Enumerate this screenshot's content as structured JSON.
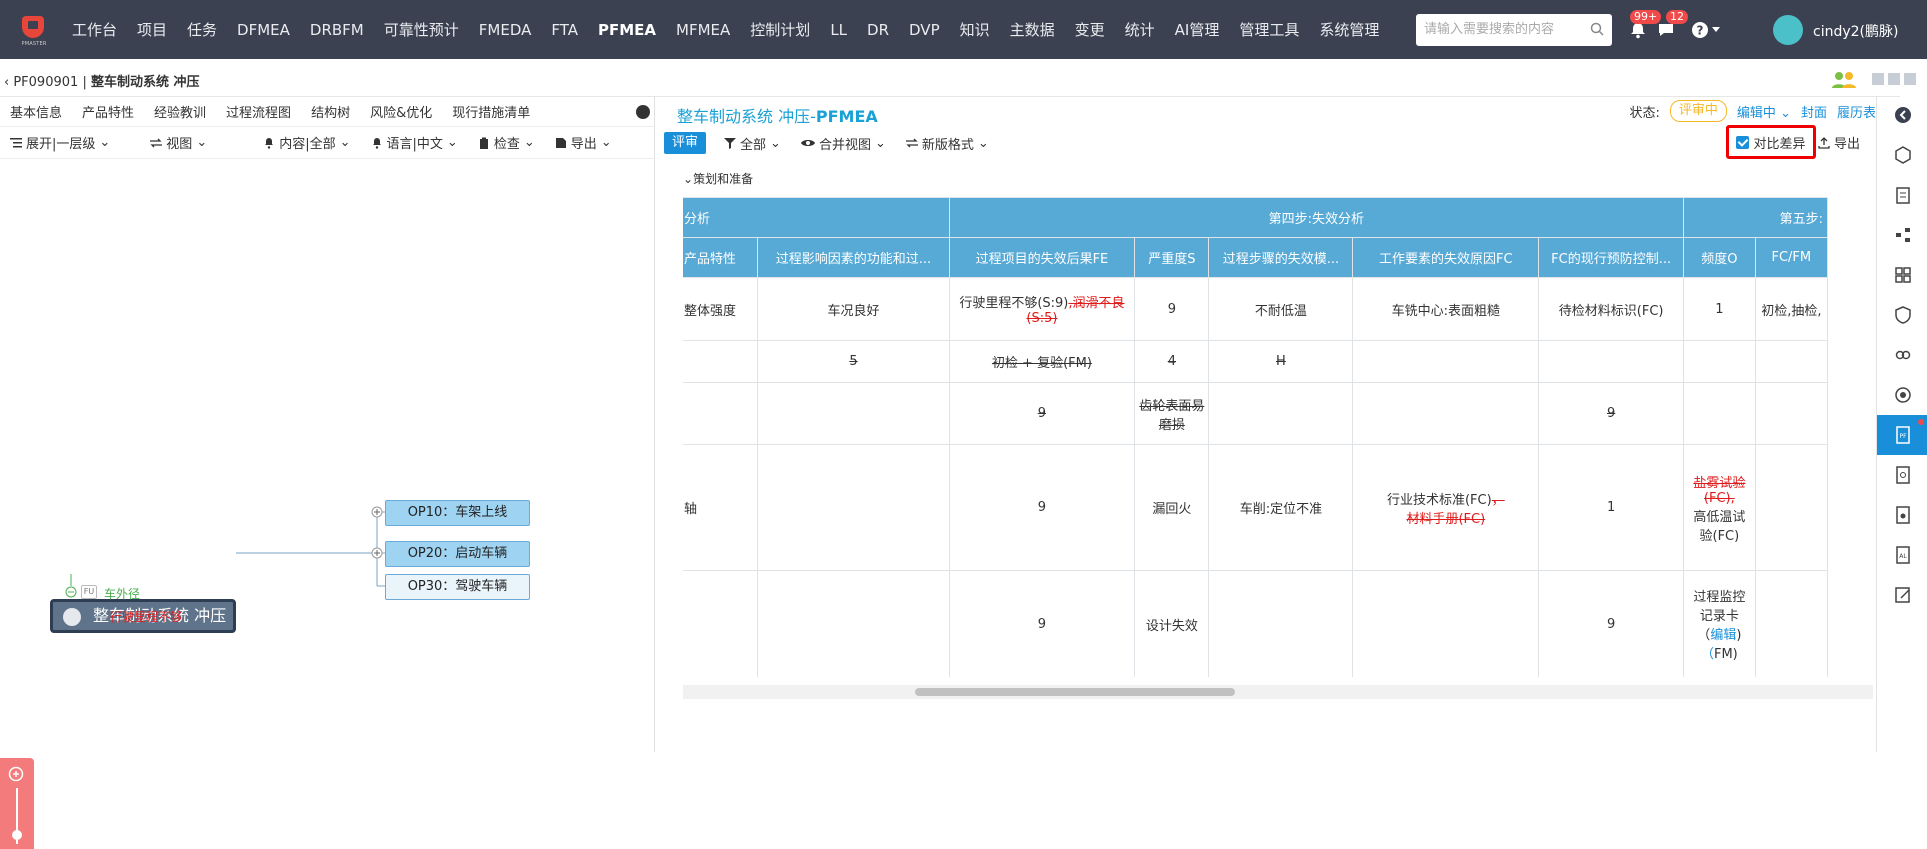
{
  "logo": {
    "text": "PMASTER"
  },
  "nav": {
    "items": [
      "工作台",
      "项目",
      "任务",
      "DFMEA",
      "DRBFM",
      "可靠性预计",
      "FMEDA",
      "FTA",
      "PFMEA",
      "MFMEA",
      "控制计划",
      "LL",
      "DR",
      "DVP",
      "知识",
      "主数据",
      "变更",
      "统计",
      "AI管理",
      "管理工具",
      "系统管理"
    ],
    "active_index": 8
  },
  "search": {
    "placeholder": "请输入需要搜索的内容"
  },
  "notifications": {
    "bell_count": "99+",
    "message_count": "12"
  },
  "user": {
    "name": "cindy2(鹏脉)"
  },
  "breadcrumb": {
    "code": "PF090901",
    "separator": "|",
    "name": "整车制动系统 冲压"
  },
  "left": {
    "tabs": [
      "基本信息",
      "产品特性",
      "经验教训",
      "过程流程图",
      "结构树",
      "风险&优化",
      "现行措施清单"
    ],
    "toolbar": {
      "expand": "展开|一层级",
      "view": "视图",
      "content": "内容|全部",
      "language": "语言|中文",
      "check": "检查",
      "export": "导出"
    },
    "tree": {
      "root": "整车制动系统 冲压",
      "children": [
        "OP10：车架上线",
        "OP20：启动车辆",
        "OP30：驾驶车辆"
      ],
      "fu_tag": "FU",
      "fu_label": "车外径",
      "failure": "行驶里程不够"
    }
  },
  "right": {
    "title_prefix": "整车制动系统 冲压-",
    "title_main": "PFMEA",
    "status_label": "状态:",
    "status_badge": "评审中",
    "edit_state": "编辑中",
    "cover_link": "封面",
    "history_link": "履历表",
    "toolbar": {
      "review_btn": "评审",
      "filter": "全部",
      "merge_view": "合并视图",
      "new_format": "新版格式",
      "diff_label": "对比差异",
      "export": "导出"
    },
    "section": "策划和准备",
    "table": {
      "group_headers": [
        "分析",
        "第四步:失效分析",
        "第五步:"
      ],
      "col_headers": [
        "产品特性",
        "过程影响因素的功能和过...",
        "过程项目的失效后果FE",
        "严重度S",
        "过程步骤的失效模...",
        "工作要素的失效原因FC",
        "FC的现行预防控制...",
        "频度O",
        "FC/FM"
      ],
      "rows": [
        {
          "c0": "整体强度",
          "c1": "车况良好",
          "c2a": "行驶里程不够(S:9)",
          "c2b": ",润滑不良(S:5)",
          "c3": "9",
          "c4": "不耐低温",
          "c5": "车铣中心:表面粗糙",
          "c6": "待检材料标识(FC)",
          "c7": "1",
          "c8": "初检,抽检,"
        },
        {
          "c0": "",
          "c1d": "5",
          "c2d": "初检 + 复验(FM)",
          "c3d": "4",
          "c4d": "H",
          "c5": "",
          "c6": "",
          "c7": "",
          "c8": ""
        },
        {
          "c0": "",
          "c1": "",
          "c2d": "9",
          "c3d": "齿轮表面易磨损",
          "c4": "",
          "c5": "",
          "c6d": "9",
          "c7": "",
          "c8": ""
        },
        {
          "c0": "轴",
          "c1": "",
          "c2": "9",
          "c3": "漏回火",
          "c4": "车削:定位不准",
          "c5a": "行业技术标准(FC)",
          "c5b": "，",
          "c5c": "材料手册(FC)",
          "c6": "1",
          "c7d": "盐雾试验(FC),",
          "c7": "高低温试验(FC)",
          "c8": ""
        },
        {
          "c0": "",
          "c1": "",
          "c2": "9",
          "c3": "设计失效",
          "c4": "",
          "c5": "",
          "c6": "9",
          "c7a": "过程监控记录卡",
          "c7b": "（",
          "c7c": "编辑",
          "c7e": "（",
          "c7f": "FM)",
          "c8": ""
        }
      ]
    }
  },
  "colors": {
    "nav_bg": "#3b4150",
    "accent": "#1a8fd9",
    "header_blue": "#57a9d6",
    "deleted_red": "#e01b1b",
    "highlight_red": "#e00000",
    "status_yellow": "#f5b829"
  },
  "icons": [
    "bell-icon",
    "chat-icon",
    "help-icon",
    "search-icon",
    "expand-icon",
    "swap-icon",
    "bell-small-icon",
    "clipboard-icon",
    "export-icon",
    "filter-icon",
    "eye-icon",
    "swap2-icon",
    "users-icon"
  ]
}
